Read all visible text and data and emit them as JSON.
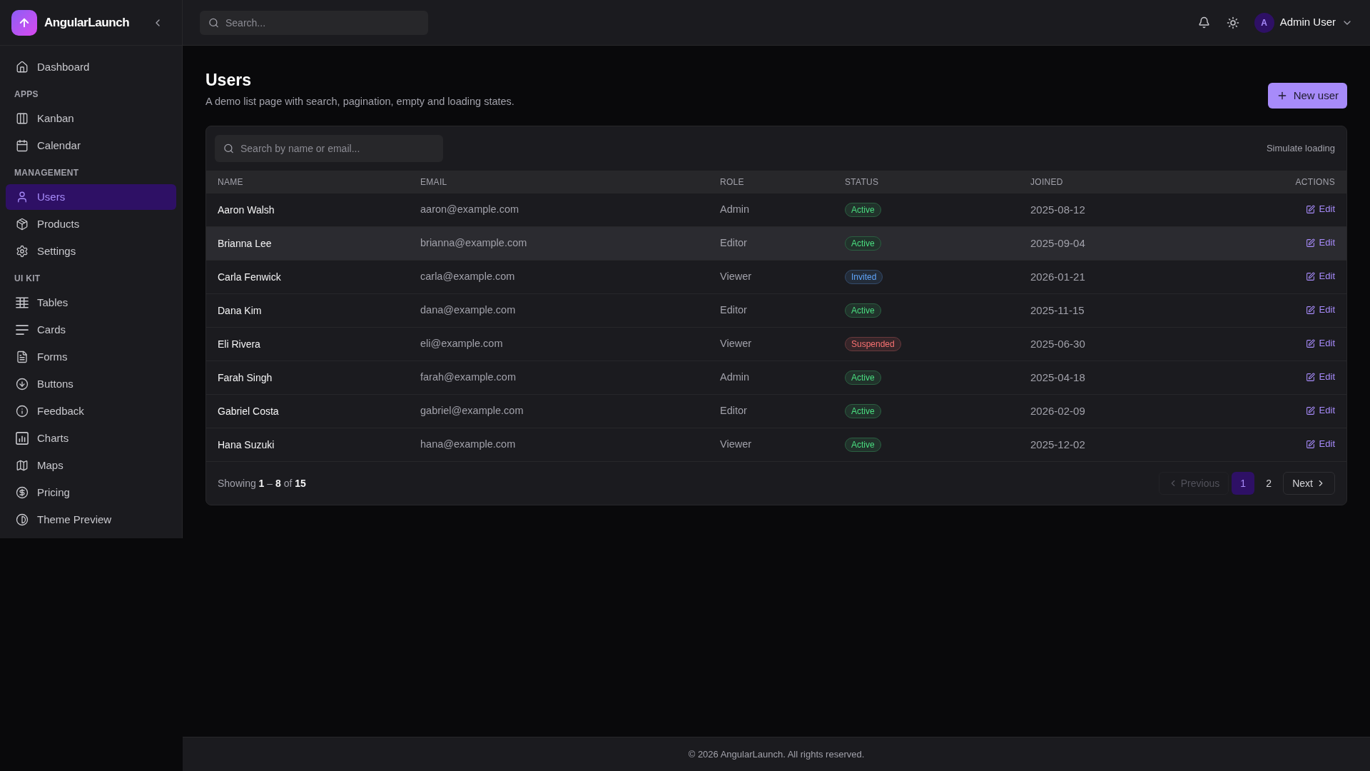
{
  "sidebar": {
    "brand": "AngularLaunch",
    "sections": [
      {
        "items": [
          {
            "label": "Dashboard",
            "selected": false
          }
        ]
      },
      {
        "title": "APPS",
        "items": [
          {
            "label": "Kanban",
            "selected": false
          },
          {
            "label": "Calendar",
            "selected": false
          }
        ]
      },
      {
        "title": "MANAGEMENT",
        "items": [
          {
            "label": "Users",
            "selected": true
          },
          {
            "label": "Products",
            "selected": false
          },
          {
            "label": "Settings",
            "selected": false
          }
        ]
      },
      {
        "title": "UI KIT",
        "items": [
          {
            "label": "Tables",
            "selected": false
          },
          {
            "label": "Cards",
            "selected": false
          },
          {
            "label": "Forms",
            "selected": false
          },
          {
            "label": "Buttons",
            "selected": false
          },
          {
            "label": "Feedback",
            "selected": false
          },
          {
            "label": "Charts",
            "selected": false
          },
          {
            "label": "Maps",
            "selected": false
          },
          {
            "label": "Pricing",
            "selected": false
          },
          {
            "label": "Theme Preview",
            "selected": false
          }
        ]
      }
    ]
  },
  "topbar": {
    "search": {
      "placeholder": "Search..."
    },
    "user": {
      "initial": "A",
      "name": "Admin User"
    }
  },
  "page": {
    "title": "Users",
    "subtitle": "A demo list page with search, pagination, empty and loading states.",
    "primary_action": "New user"
  },
  "table_card": {
    "search": {
      "placeholder": "Search by name or email..."
    },
    "toolbar_action": "Simulate loading",
    "columns": [
      "NAME",
      "EMAIL",
      "ROLE",
      "STATUS",
      "JOINED",
      "ACTIONS"
    ],
    "rows": [
      {
        "name": "Aaron Walsh",
        "email": "aaron@example.com",
        "role": "Admin",
        "status": {
          "label": "Active",
          "color": "#4ade80"
        },
        "joined": "2025-08-12",
        "action": "Edit",
        "highlighted": false
      },
      {
        "name": "Brianna Lee",
        "email": "brianna@example.com",
        "role": "Editor",
        "status": {
          "label": "Active",
          "color": "#4ade80"
        },
        "joined": "2025-09-04",
        "action": "Edit",
        "highlighted": true
      },
      {
        "name": "Carla Fenwick",
        "email": "carla@example.com",
        "role": "Viewer",
        "status": {
          "label": "Invited",
          "color": "#60a5fa"
        },
        "joined": "2026-01-21",
        "action": "Edit",
        "highlighted": false
      },
      {
        "name": "Dana Kim",
        "email": "dana@example.com",
        "role": "Editor",
        "status": {
          "label": "Active",
          "color": "#4ade80"
        },
        "joined": "2025-11-15",
        "action": "Edit",
        "highlighted": false
      },
      {
        "name": "Eli Rivera",
        "email": "eli@example.com",
        "role": "Viewer",
        "status": {
          "label": "Suspended",
          "color": "#f87171"
        },
        "joined": "2025-06-30",
        "action": "Edit",
        "highlighted": false
      },
      {
        "name": "Farah Singh",
        "email": "farah@example.com",
        "role": "Admin",
        "status": {
          "label": "Active",
          "color": "#4ade80"
        },
        "joined": "2025-04-18",
        "action": "Edit",
        "highlighted": false
      },
      {
        "name": "Gabriel Costa",
        "email": "gabriel@example.com",
        "role": "Editor",
        "status": {
          "label": "Active",
          "color": "#4ade80"
        },
        "joined": "2026-02-09",
        "action": "Edit",
        "highlighted": false
      },
      {
        "name": "Hana Suzuki",
        "email": "hana@example.com",
        "role": "Viewer",
        "status": {
          "label": "Active",
          "color": "#4ade80"
        },
        "joined": "2025-12-02",
        "action": "Edit",
        "highlighted": false
      }
    ],
    "summary": "Showing **1** – **8** of **15**",
    "pagination": {
      "previous": {
        "label": "Previous",
        "disabled": true
      },
      "pages": [
        {
          "label": "1",
          "selected": true
        },
        {
          "label": "2",
          "selected": false
        }
      ],
      "next": {
        "label": "Next",
        "disabled": false
      }
    }
  },
  "footer": {
    "text": "© 2026 AngularLaunch. All rights reserved."
  }
}
